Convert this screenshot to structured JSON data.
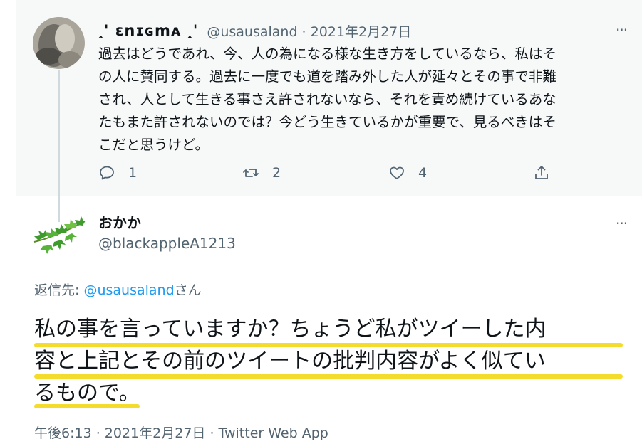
{
  "parent_tweet": {
    "display_name": "␣␣ꮛꮑꮖꮐꮇꭺ␣␣",
    "display_name_shown": "ꞈꞌ ɛnɪɢmᴀ ꞈꞌ",
    "handle": "@usausaland",
    "date": "2021年2月27日",
    "meta_line": "@usausaland · 2021年2月27日",
    "more": "···",
    "lines": [
      "過去はどうであれ、今、人の為になる様な生き方をしているなら、私はそ",
      "の人に賛同する。過去に一度でも道を踏み外した人が延々とその事で非難",
      "され、人として生きる事さえ許されないなら、それを責め続けているあな",
      "たもまた許されないのでは？今どう生きているかが重要で、見るべきはそ",
      "こだと思うけど。"
    ],
    "reply_count": "1",
    "retweet_count": "2",
    "like_count": "4"
  },
  "reply_tweet": {
    "display_name": "おかか",
    "handle": "@blackappleA1213",
    "more": "···",
    "reply_to_prefix": "返信先: ",
    "reply_to_mention": "@usausaland",
    "reply_to_suffix": "さん",
    "lines": [
      "私の事を言っていますか？ちょうど私がツイーした内",
      "容と上記とその前のツイートの批判内容がよく似てい",
      "るもので。"
    ],
    "timestamp": "午後6:13 · 2021年2月27日 · Twitter Web App"
  },
  "colors": {
    "accent": "#1d9bf0",
    "muted": "#536471",
    "highlight": "#f3dc2b",
    "parent_bg": "#f7f9f9"
  }
}
